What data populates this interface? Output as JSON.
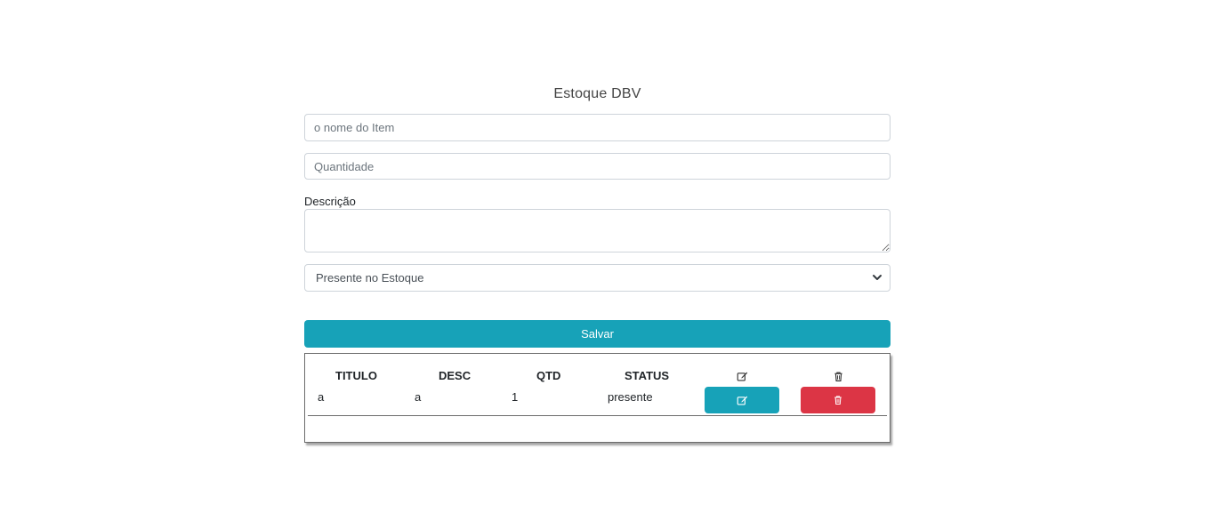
{
  "form": {
    "title": "Estoque DBV",
    "name_placeholder": "o nome do Item",
    "quantity_placeholder": "Quantidade",
    "description_label": "Descrição",
    "description_value": "",
    "status_selected": "Presente no Estoque",
    "save_label": "Salvar"
  },
  "table": {
    "headers": [
      "TITULO",
      "DESC",
      "QTD",
      "STATUS"
    ],
    "header_icons": [
      "edit-icon",
      "trash-icon"
    ],
    "rows": [
      {
        "titulo": "a",
        "desc": "a",
        "qtd": "1",
        "status": "presente"
      }
    ]
  },
  "colors": {
    "accent": "#17a2b8",
    "danger": "#dc3545",
    "border": "#ced4da"
  }
}
